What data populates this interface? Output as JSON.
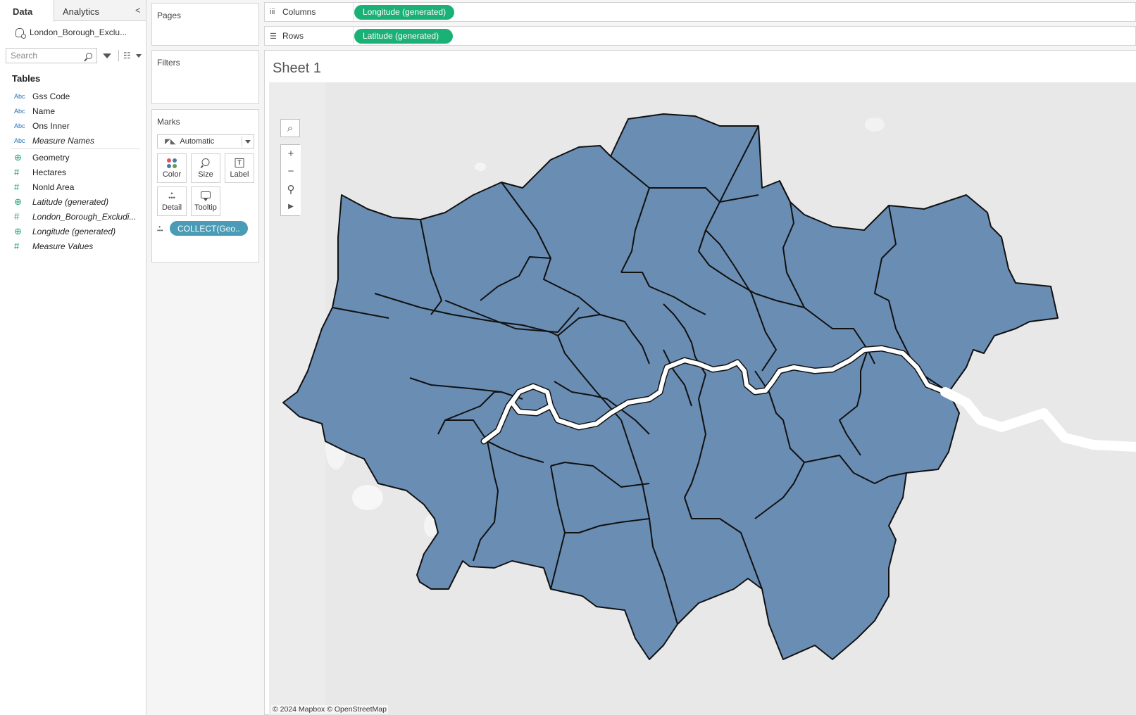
{
  "data_pane": {
    "tab_data": "Data",
    "tab_analytics": "Analytics",
    "collapse_glyph": "<",
    "datasource": "London_Borough_Exclu...",
    "search_placeholder": "Search",
    "tables_header": "Tables",
    "fields": [
      {
        "type": "Abc",
        "name": "Gss Code"
      },
      {
        "type": "Abc",
        "name": "Name"
      },
      {
        "type": "Abc",
        "name": "Ons Inner"
      },
      {
        "type": "Abc",
        "name": "Measure Names"
      },
      {
        "type": "geo",
        "name": "Geometry"
      },
      {
        "type": "#",
        "name": "Hectares"
      },
      {
        "type": "#",
        "name": "Nonld Area"
      },
      {
        "type": "geo",
        "name": "Latitude (generated)"
      },
      {
        "type": "#",
        "name": "London_Borough_Excludi..."
      },
      {
        "type": "geo",
        "name": "Longitude (generated)"
      },
      {
        "type": "#",
        "name": "Measure Values"
      }
    ]
  },
  "cards": {
    "pages_title": "Pages",
    "filters_title": "Filters",
    "marks_title": "Marks",
    "mark_type": "Automatic",
    "color_label": "Color",
    "size_label": "Size",
    "label_label": "Label",
    "detail_label": "Detail",
    "tooltip_label": "Tooltip",
    "marks_pill": "COLLECT(Geo..",
    "label_icon_glyph": "T"
  },
  "shelves": {
    "columns_label": "Columns",
    "columns_pill": "Longitude (generated)",
    "rows_label": "Rows",
    "rows_pill": "Latitude (generated)"
  },
  "sheet": {
    "title": "Sheet 1",
    "attribution": "© 2024 Mapbox © OpenStreetMap"
  },
  "colors": {
    "borough_fill": "#6a8db3",
    "river": "#ffffff",
    "map_bg": "#e8e8e8",
    "pill_green": "#1bb075",
    "pill_blue": "#4a9bb5"
  },
  "icons": {
    "search": "search-icon",
    "filter": "funnel-icon",
    "zoom_in": "plus-icon",
    "zoom_out": "minus-icon",
    "pin": "pin-icon",
    "play": "play-icon"
  }
}
